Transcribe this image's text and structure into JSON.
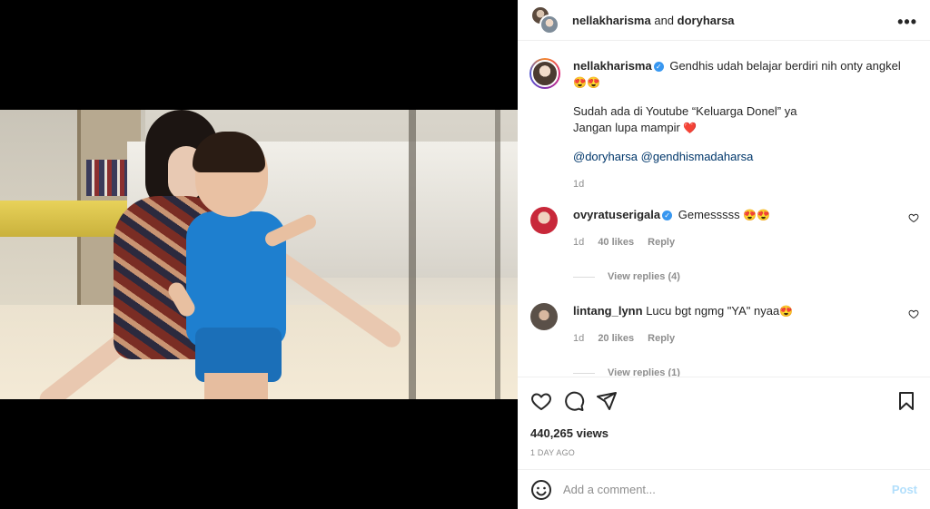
{
  "header": {
    "user1": "nellakharisma",
    "and_text": "and",
    "user2": "doryharsa",
    "more_label": "•••"
  },
  "caption": {
    "username": "nellakharisma",
    "verified_mark": "✓",
    "line1": "Gendhis udah belajar berdiri nih onty angkel",
    "emojis1": "😍😍",
    "para2a": "Sudah ada di Youtube “Keluarga Donel” ya",
    "para2b": "Jangan lupa mampir",
    "heart": "❤️",
    "mention1": "@doryharsa",
    "mention2": "@gendhismadaharsa",
    "time": "1d"
  },
  "comments": [
    {
      "username": "ovyratuserigala",
      "verified_mark": "✓",
      "text": "Gemesssss",
      "emoji": "😍😍",
      "time": "1d",
      "likes": "40 likes",
      "reply": "Reply",
      "view_replies": "View replies (4)"
    },
    {
      "username": "lintang_lynn",
      "text": "Lucu bgt ngmg \"YA\" nyaa",
      "emoji": "😍",
      "time": "1d",
      "likes": "20 likes",
      "reply": "Reply",
      "view_replies": "View replies (1)"
    }
  ],
  "stats": {
    "views": "440,265 views",
    "ago": "1 DAY AGO"
  },
  "add_comment": {
    "placeholder": "Add a comment...",
    "post_label": "Post"
  },
  "colors": {
    "verified": "#3897f0",
    "mention": "#00376b",
    "post_disabled": "#b2dffc"
  },
  "icons": [
    "heart-icon",
    "comment-icon",
    "share-icon",
    "bookmark-icon",
    "emoji-icon",
    "more-icon"
  ]
}
